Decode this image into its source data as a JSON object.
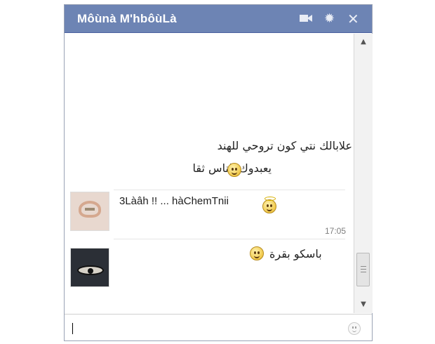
{
  "chat": {
    "title": "Môùnà M'hbôùLà",
    "header_icons": [
      "video-camera-icon",
      "gear-icon",
      "close-icon"
    ],
    "colors": {
      "titlebar": "#6d84b4",
      "title_text": "#ffffff"
    }
  },
  "messages": [
    {
      "line": "علابالك نتي كون تروحي للهند"
    },
    {
      "line": "يعبدوك الناس ثقا"
    },
    {
      "text": "3Làâh !! ... hàChemTnii"
    },
    {
      "time": "17:05",
      "text": "باسكو بقرة"
    }
  ],
  "input": {
    "placeholder": "",
    "emoji_icon": "smile-icon"
  }
}
